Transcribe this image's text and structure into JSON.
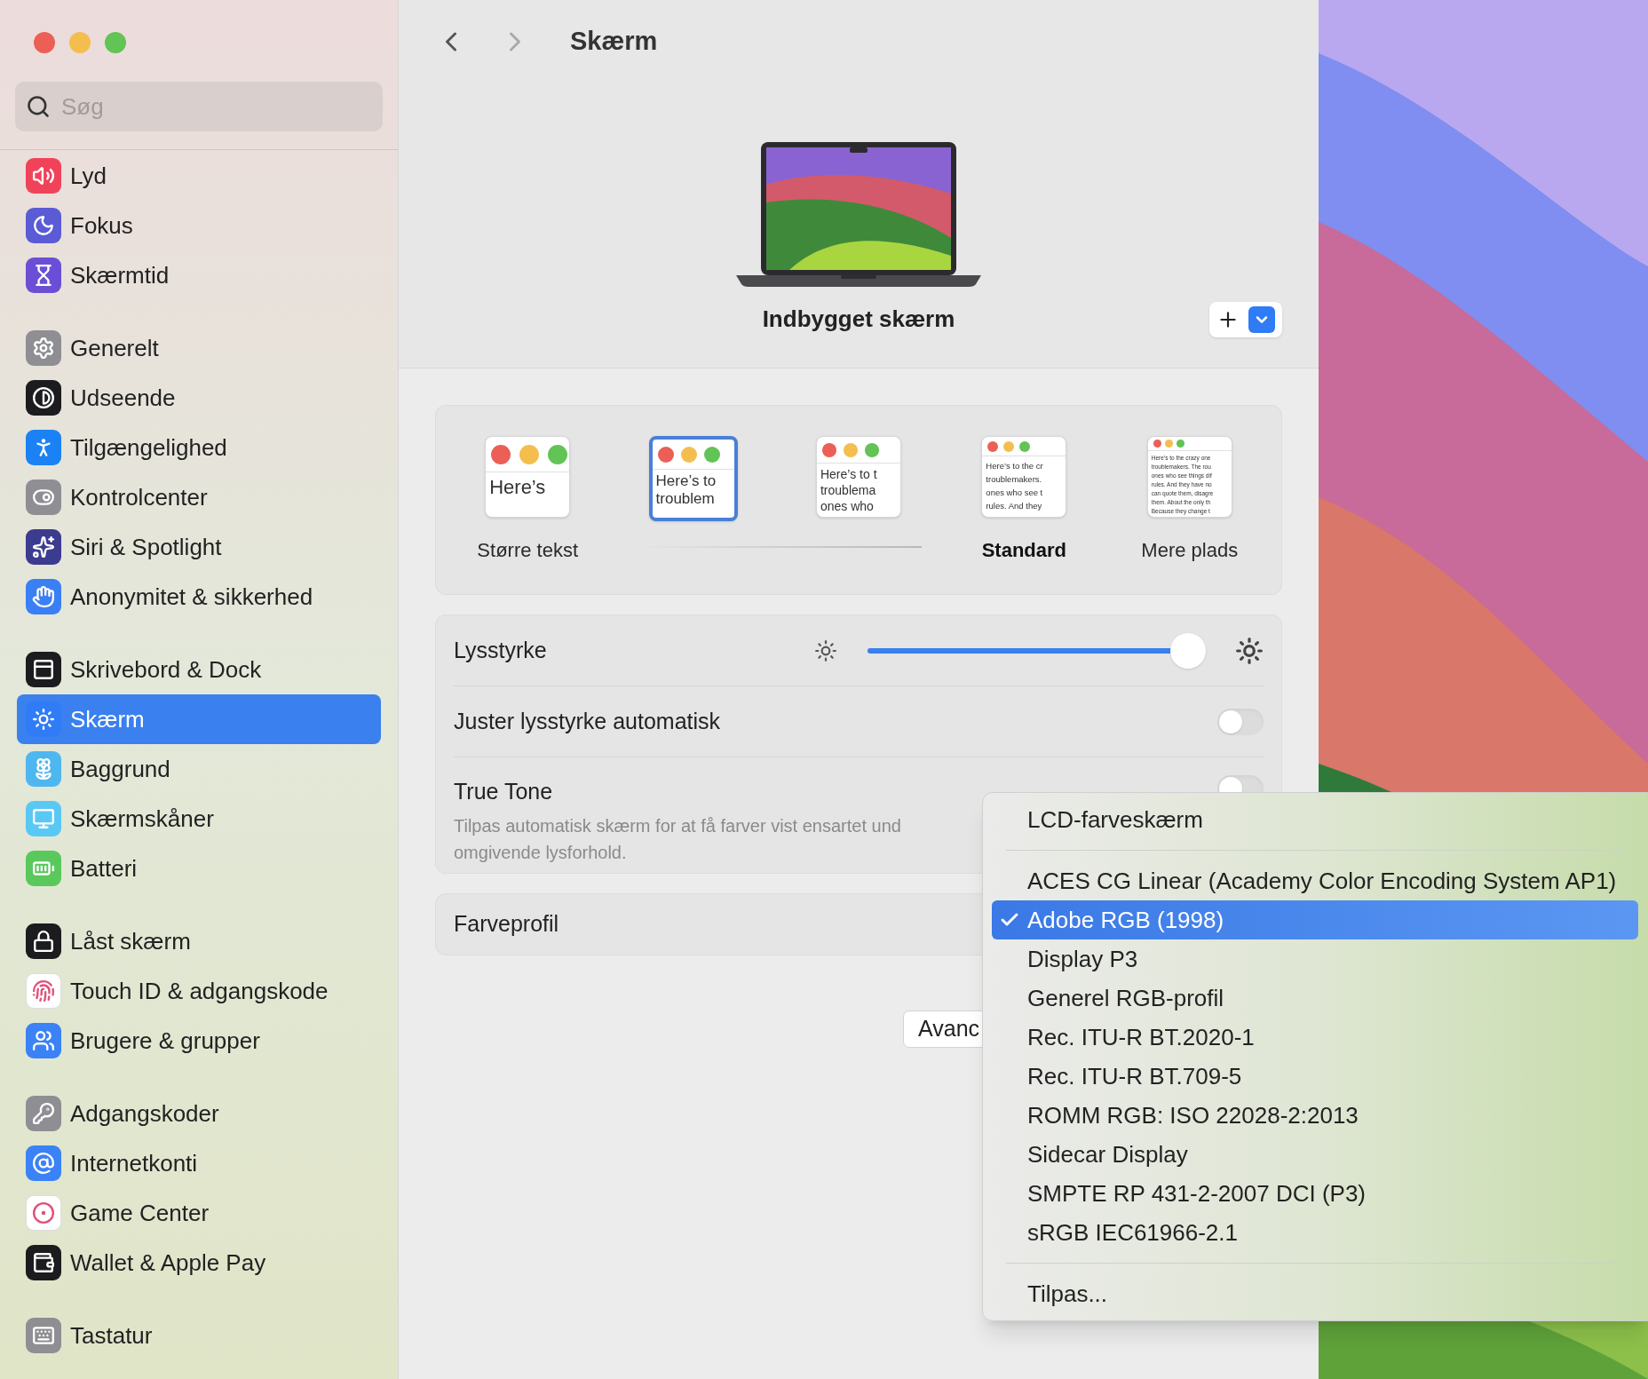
{
  "sidebar": {
    "search": {
      "placeholder": "Søg"
    },
    "groups": [
      {
        "items": [
          {
            "label": "Lyd",
            "color": "#f0435a",
            "selected": false
          },
          {
            "label": "Fokus",
            "color": "#5b5bd6",
            "selected": false
          },
          {
            "label": "Skærmtid",
            "color": "#6a4fd6",
            "selected": false
          }
        ]
      },
      {
        "items": [
          {
            "label": "Generelt",
            "color": "#8e8e93",
            "selected": false
          },
          {
            "label": "Udseende",
            "color": "#1c1c1e",
            "selected": false
          },
          {
            "label": "Tilgængelighed",
            "color": "#1a82f5",
            "selected": false
          },
          {
            "label": "Kontrolcenter",
            "color": "#8e8e93",
            "selected": false
          },
          {
            "label": "Siri & Spotlight",
            "color": "#3b3b8f",
            "selected": false
          },
          {
            "label": "Anonymitet & sikkerhed",
            "color": "#3b7ff5",
            "selected": false
          }
        ]
      },
      {
        "items": [
          {
            "label": "Skrivebord & Dock",
            "color": "#1c1c1e",
            "selected": false
          },
          {
            "label": "Skærm",
            "color": "#2f7cf6",
            "selected": true
          },
          {
            "label": "Baggrund",
            "color": "#4fb7f0",
            "selected": false
          },
          {
            "label": "Skærmskåner",
            "color": "#5ac8f5",
            "selected": false
          },
          {
            "label": "Batteri",
            "color": "#5ac85a",
            "selected": false
          }
        ]
      },
      {
        "items": [
          {
            "label": "Låst skærm",
            "color": "#1c1c1e",
            "selected": false
          },
          {
            "label": "Touch ID & adgangskode",
            "color": "#ffffff",
            "selected": false
          },
          {
            "label": "Brugere & grupper",
            "color": "#3b82f6",
            "selected": false
          }
        ]
      },
      {
        "items": [
          {
            "label": "Adgangskoder",
            "color": "#8e8e93",
            "selected": false
          },
          {
            "label": "Internetkonti",
            "color": "#3b82f6",
            "selected": false
          },
          {
            "label": "Game Center",
            "color": "#ffffff",
            "selected": false
          },
          {
            "label": "Wallet & Apple Pay",
            "color": "#1c1c1e",
            "selected": false
          }
        ]
      },
      {
        "items": [
          {
            "label": "Tastatur",
            "color": "#8e8e93",
            "selected": false
          }
        ]
      }
    ]
  },
  "header": {
    "title": "Skærm"
  },
  "display": {
    "name": "Indbygget skærm"
  },
  "resolution_options": [
    {
      "lines": [
        "Here’s"
      ],
      "label": "Større tekst",
      "selected": false,
      "is_default": false
    },
    {
      "lines": [
        "Here’s to",
        "troublem"
      ],
      "selected": true
    },
    {
      "lines": [
        "Here’s to t",
        "troublema",
        "ones who"
      ],
      "selected": false
    },
    {
      "lines": [
        "Here’s to the cr",
        "troublemakers.",
        "ones who see t",
        "rules. And they"
      ],
      "label": "Standard",
      "selected": false,
      "is_default": true
    },
    {
      "lines": [
        "Here’s to the crazy one",
        "troublemakers. The rou",
        "ones who see things dif",
        "rules. And they have no",
        "can quote them, disagre",
        "them. About the only th",
        "Because they change t"
      ],
      "label": "Mere plads",
      "selected": false,
      "is_default": false
    }
  ],
  "brightness": {
    "label": "Lysstyrke",
    "level": 0.95
  },
  "auto_brightness": {
    "label": "Juster lysstyrke automatisk",
    "on": false
  },
  "true_tone": {
    "label": "True Tone",
    "description": "Tilpas automatisk skærm for at få farver vist ensartet und",
    "description_2": "omgivende lysforhold.",
    "on": false
  },
  "color_profile": {
    "label": "Farveprofil"
  },
  "advanced_button": {
    "label": "Avanc"
  },
  "profile_menu": [
    {
      "kind": "item",
      "label": "LCD-farveskærm",
      "selected": false
    },
    {
      "kind": "separator"
    },
    {
      "kind": "item",
      "label": "ACES CG Linear (Academy Color Encoding System AP1)",
      "selected": false
    },
    {
      "kind": "item",
      "label": "Adobe RGB (1998)",
      "selected": true
    },
    {
      "kind": "item",
      "label": "Display P3",
      "selected": false
    },
    {
      "kind": "item",
      "label": "Generel RGB-profil",
      "selected": false
    },
    {
      "kind": "item",
      "label": "Rec. ITU-R BT.2020-1",
      "selected": false
    },
    {
      "kind": "item",
      "label": "Rec. ITU-R BT.709-5",
      "selected": false
    },
    {
      "kind": "item",
      "label": "ROMM RGB: ISO 22028-2:2013",
      "selected": false
    },
    {
      "kind": "item",
      "label": "Sidecar Display",
      "selected": false
    },
    {
      "kind": "item",
      "label": "SMPTE RP 431-2-2007 DCI (P3)",
      "selected": false
    },
    {
      "kind": "item",
      "label": "sRGB IEC61966-2.1",
      "selected": false
    },
    {
      "kind": "separator"
    },
    {
      "kind": "item",
      "label": "Tilpas...",
      "selected": false
    }
  ]
}
